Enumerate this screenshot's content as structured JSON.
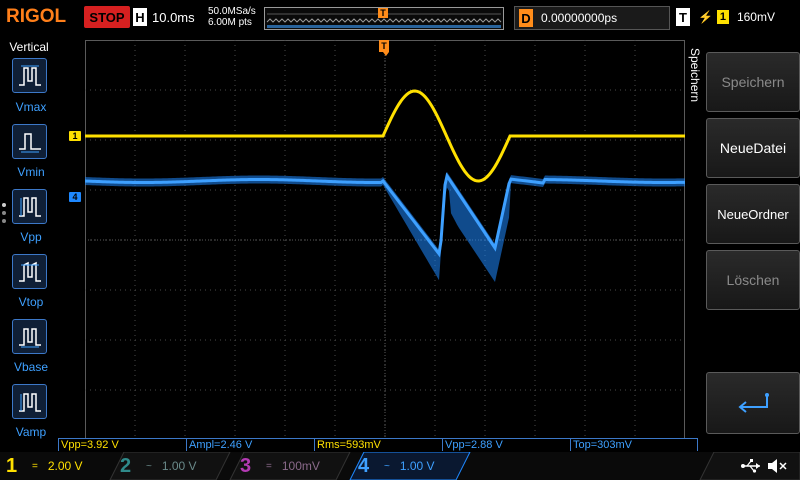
{
  "header": {
    "logo": "RIGOL",
    "run_state": "STOP",
    "timebase_tag": "H",
    "timebase": "10.0ms",
    "sample_rate": "50.0MSa/s",
    "memory_depth": "6.00M pts",
    "trigger_marker": "T",
    "delay_tag": "D",
    "delay_value": "0.00000000ps",
    "trigger_tag": "T",
    "trigger_source": "1",
    "trigger_level": "160mV"
  },
  "left_panel": {
    "title": "Vertical",
    "items": [
      {
        "label": "Vmax"
      },
      {
        "label": "Vmin"
      },
      {
        "label": "Vpp"
      },
      {
        "label": "Vtop"
      },
      {
        "label": "Vbase"
      },
      {
        "label": "Vamp"
      }
    ]
  },
  "right_menu": {
    "title": "Speichern",
    "buttons": [
      {
        "label": "Speichern",
        "enabled": false
      },
      {
        "label": "NeueDatei",
        "enabled": true
      },
      {
        "label": "NeueOrdner",
        "enabled": true
      },
      {
        "label": "Löschen",
        "enabled": false
      }
    ]
  },
  "markers": {
    "ch1": "1",
    "ch4": "4",
    "trigger_top": "T",
    "trigger_level": "T"
  },
  "measurements": [
    {
      "text": "Vpp=3.92 V",
      "color": "yellow"
    },
    {
      "text": "Ampl=2.46 V",
      "color": "blue"
    },
    {
      "text": "Rms=593mV",
      "color": "yellow"
    },
    {
      "text": "Vpp=2.88 V",
      "color": "blue"
    },
    {
      "text": "Top=303mV",
      "color": "blue"
    }
  ],
  "channels": [
    {
      "num": "1",
      "coupling": "=",
      "scale": "2.00 V",
      "color": "#ffe000",
      "active": true
    },
    {
      "num": "2",
      "coupling": "~",
      "scale": "1.00 V",
      "color": "#2f8a8a",
      "active": false
    },
    {
      "num": "3",
      "coupling": "=",
      "scale": "100mV",
      "color": "#b33ab3",
      "active": false
    },
    {
      "num": "4",
      "coupling": "~",
      "scale": "1.00 V",
      "color": "#3ea0ff",
      "active": true
    }
  ],
  "colors": {
    "ch1": "#ffe000",
    "ch4": "#1e88ff",
    "accent": "#ff8c1a",
    "stop": "#d62020"
  },
  "icons": [
    "usb-icon",
    "speaker-muted-icon",
    "enter-icon"
  ]
}
